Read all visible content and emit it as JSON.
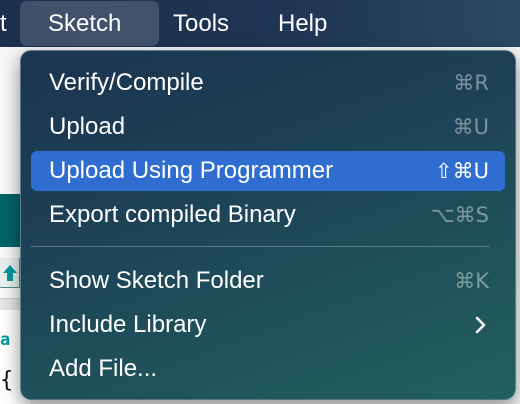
{
  "menubar": {
    "items": [
      {
        "label": "t"
      },
      {
        "label": "Sketch",
        "active": true
      },
      {
        "label": "Tools"
      },
      {
        "label": "Help"
      }
    ]
  },
  "background": {
    "code_keyword": "a",
    "code_brace": "{"
  },
  "sketch_menu": {
    "items": [
      {
        "label": "Verify/Compile",
        "shortcut": "⌘R"
      },
      {
        "label": "Upload",
        "shortcut": "⌘U"
      },
      {
        "label": "Upload Using Programmer",
        "shortcut": "⇧⌘U",
        "highlighted": true
      },
      {
        "label": "Export compiled Binary",
        "shortcut": "⌥⌘S"
      },
      {
        "label": "Show Sketch Folder",
        "shortcut": "⌘K"
      },
      {
        "label": "Include Library",
        "submenu_icon": "chevron-right-icon"
      },
      {
        "label": "Add File..."
      }
    ]
  },
  "colors": {
    "highlight": "#2f6dd1",
    "arduino_teal": "#00979d"
  }
}
